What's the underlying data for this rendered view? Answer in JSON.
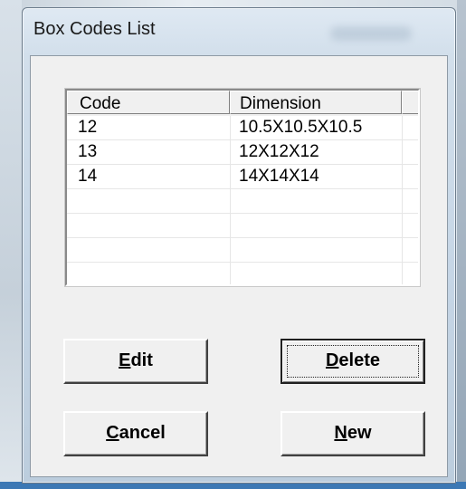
{
  "window": {
    "title": "Box Codes List"
  },
  "list": {
    "columns": [
      "Code",
      "Dimension"
    ],
    "rows": [
      {
        "code": "12",
        "dimension": "10.5X10.5X10.5"
      },
      {
        "code": "13",
        "dimension": "12X12X12"
      },
      {
        "code": "14",
        "dimension": "14X14X14"
      }
    ]
  },
  "buttons": {
    "edit": {
      "mnemonic": "E",
      "rest": "dit"
    },
    "delete": {
      "mnemonic": "D",
      "rest": "elete"
    },
    "cancel": {
      "mnemonic": "C",
      "rest": "ancel"
    },
    "new": {
      "mnemonic": "N",
      "rest": "ew"
    }
  }
}
